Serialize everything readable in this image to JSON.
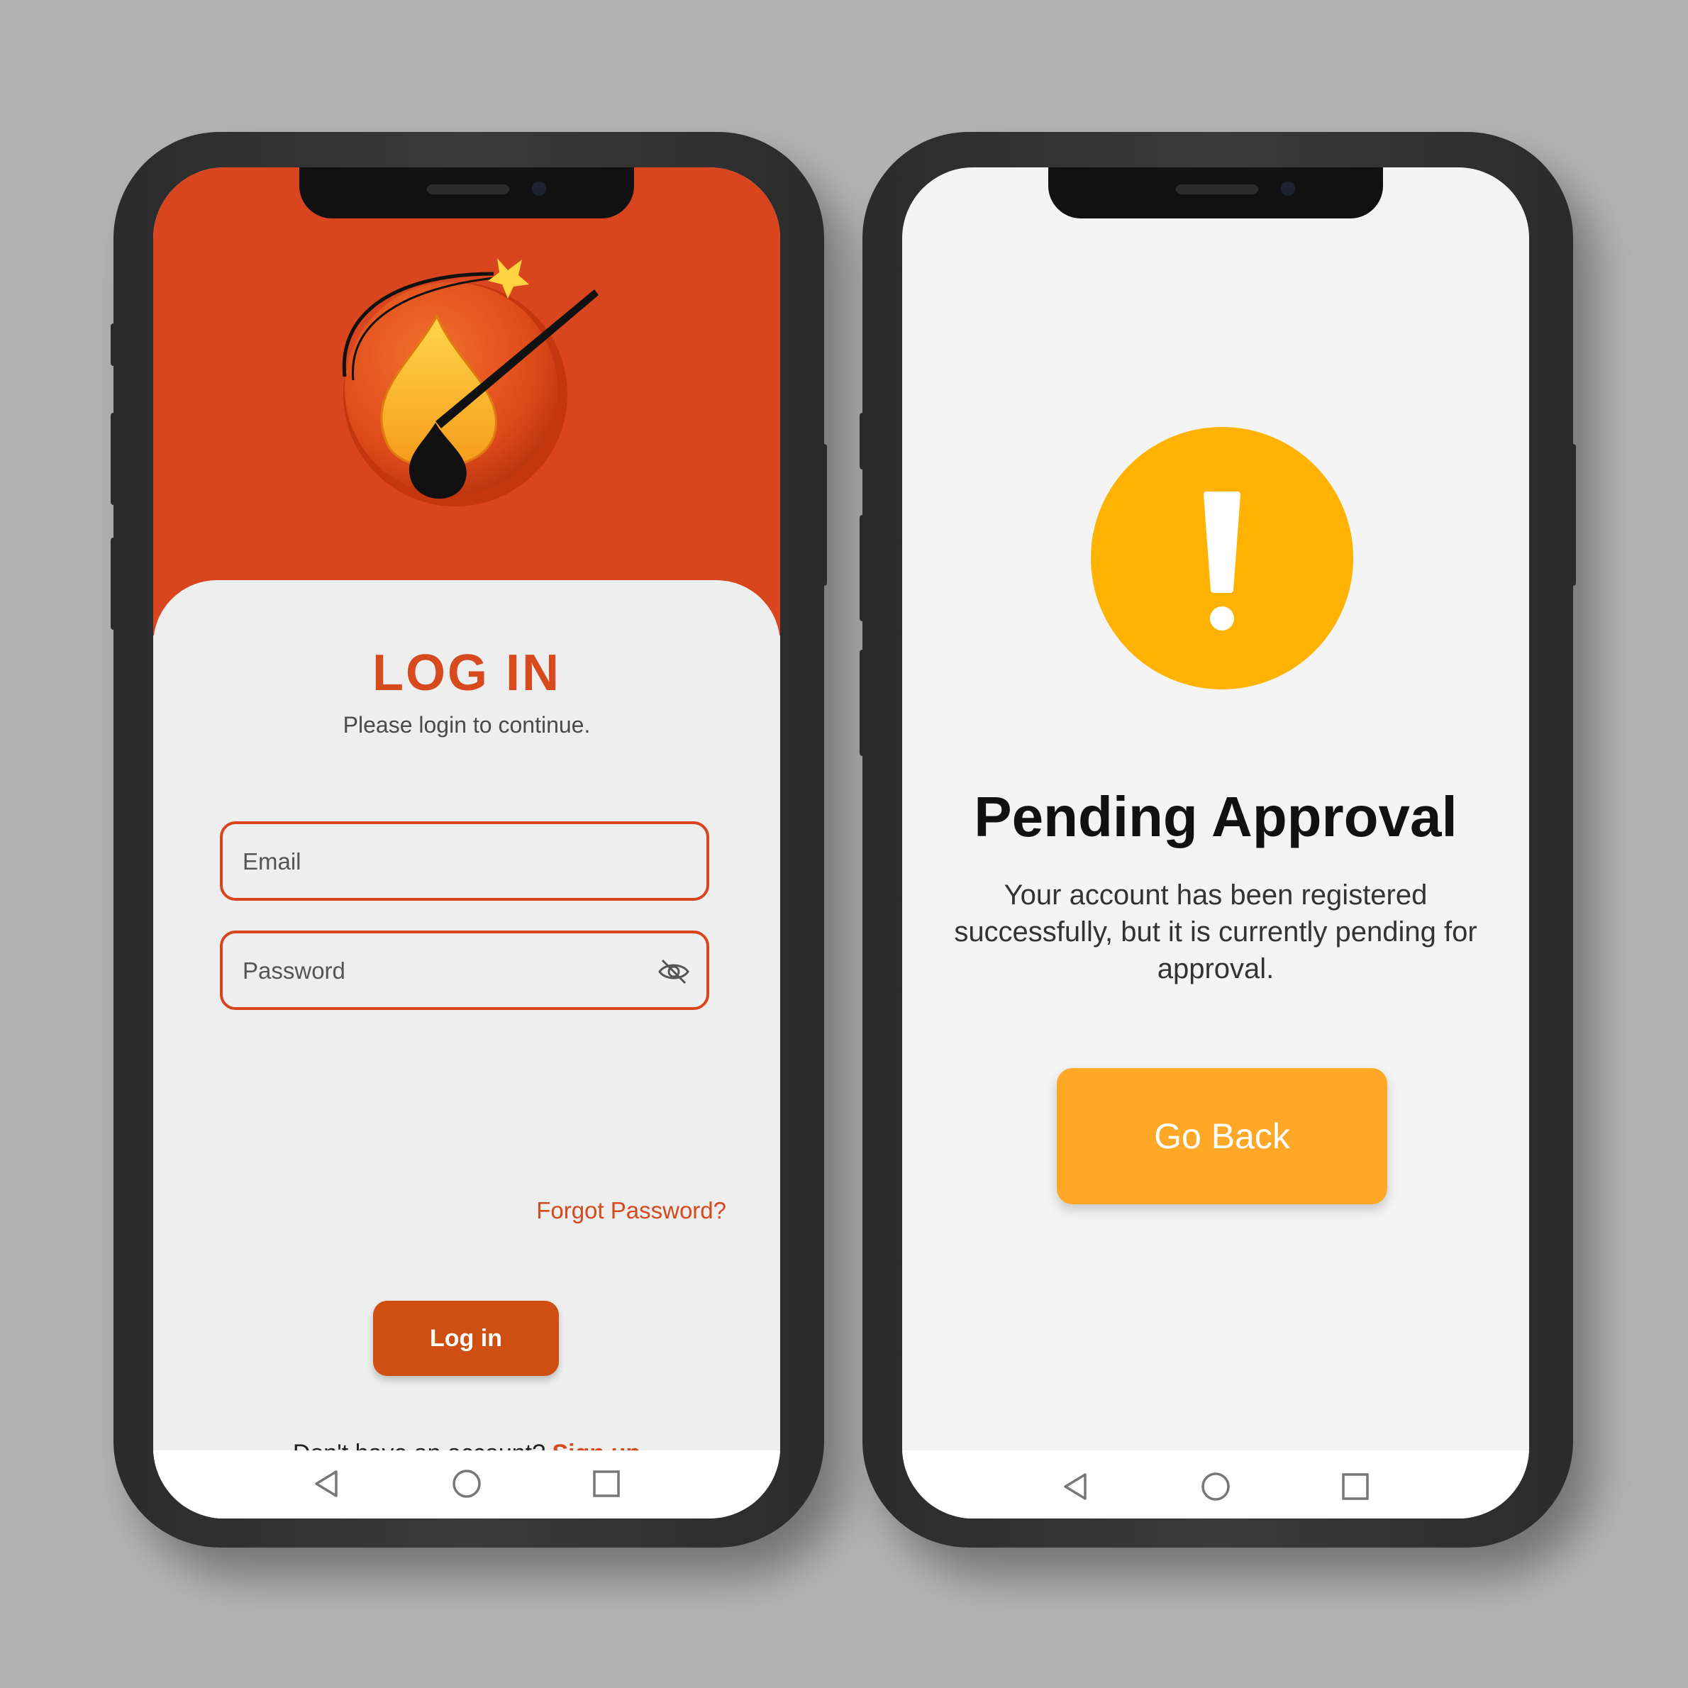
{
  "login_screen": {
    "title": "LOG IN",
    "subtitle": "Please login to continue.",
    "email_placeholder": "Email",
    "password_placeholder": "Password",
    "forgot_password": "Forgot Password?",
    "login_button": "Log in",
    "no_account_text": "Don't have an account?",
    "signup_link": "Sign up"
  },
  "pending_screen": {
    "title": "Pending Approval",
    "message": "Your account has been registered successfully, but it is currently pending for approval.",
    "go_back_button": "Go Back",
    "warning_icon": "exclamation-icon"
  },
  "navigation": {
    "icons": [
      "back-icon",
      "home-icon",
      "recents-icon"
    ]
  },
  "colors": {
    "brand_orange": "#d8451f",
    "button_orange": "#cf4e12",
    "warning_yellow": "#ffb300",
    "go_back_orange": "#ffa726"
  }
}
